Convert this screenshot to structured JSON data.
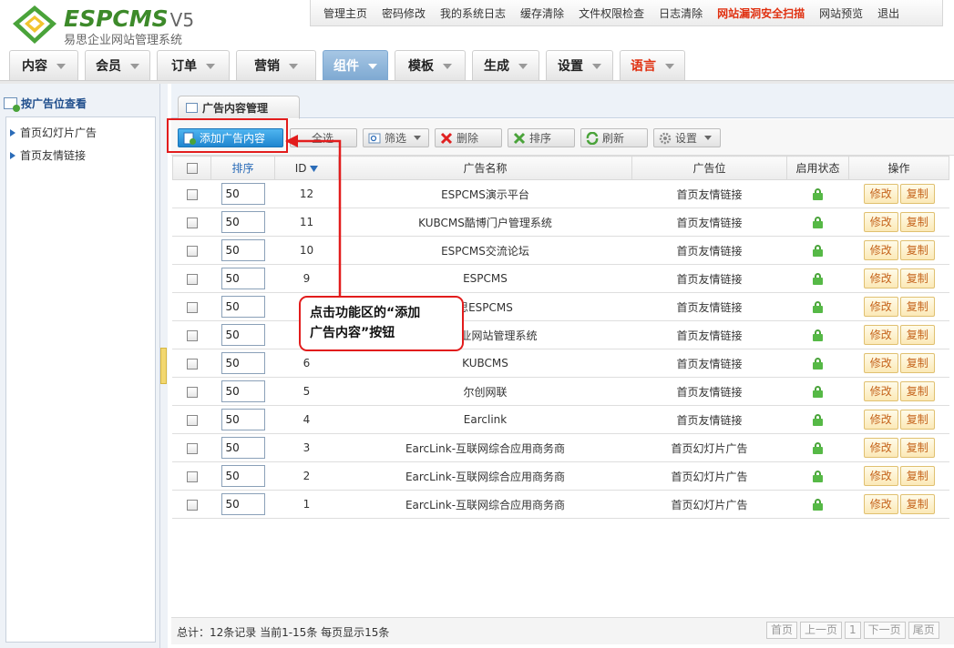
{
  "header": {
    "brand": "ESPCMS",
    "version": "V5",
    "subtitle": "易思企业网站管理系统"
  },
  "top_nav": [
    "管理主页",
    "密码修改",
    "我的系统日志",
    "缓存清除",
    "文件权限检查",
    "日志清除",
    "网站漏洞安全扫描",
    "网站预览",
    "退出"
  ],
  "main_nav": [
    "内容",
    "会员",
    "订单",
    "营销",
    "组件",
    "模板",
    "生成",
    "设置",
    "语言"
  ],
  "sidebar": {
    "title": "按广告位查看",
    "items": [
      "首页幻灯片广告",
      "首页友情链接"
    ]
  },
  "page_tab": "广告内容管理",
  "toolbar": {
    "add": "添加广告内容",
    "select_all": "全选",
    "filter": "筛选",
    "delete": "删除",
    "sort": "排序",
    "refresh": "刷新",
    "settings": "设置"
  },
  "table": {
    "headers": {
      "sort": "排序",
      "id": "ID",
      "name": "广告名称",
      "position": "广告位",
      "status": "启用状态",
      "ops": "操作"
    },
    "edit_label": "修改",
    "copy_label": "复制",
    "rows": [
      {
        "order": "50",
        "id": "12",
        "name": "ESPCMS演示平台",
        "position": "首页友情链接"
      },
      {
        "order": "50",
        "id": "11",
        "name": "KUBCMS酷博门户管理系统",
        "position": "首页友情链接"
      },
      {
        "order": "50",
        "id": "10",
        "name": "ESPCMS交流论坛",
        "position": "首页友情链接"
      },
      {
        "order": "50",
        "id": "9",
        "name": "ESPCMS",
        "position": "首页友情链接"
      },
      {
        "order": "50",
        "id": "",
        "name": "思ESPCMS",
        "position": "首页友情链接"
      },
      {
        "order": "50",
        "id": "",
        "name": "MS企业网站管理系统",
        "position": "首页友情链接"
      },
      {
        "order": "50",
        "id": "6",
        "name": "KUBCMS",
        "position": "首页友情链接"
      },
      {
        "order": "50",
        "id": "5",
        "name": "尔创网联",
        "position": "首页友情链接"
      },
      {
        "order": "50",
        "id": "4",
        "name": "Earclink",
        "position": "首页友情链接"
      },
      {
        "order": "50",
        "id": "3",
        "name": "EarcLink-互联网综合应用商务商",
        "position": "首页幻灯片广告"
      },
      {
        "order": "50",
        "id": "2",
        "name": "EarcLink-互联网综合应用商务商",
        "position": "首页幻灯片广告"
      },
      {
        "order": "50",
        "id": "1",
        "name": "EarcLink-互联网综合应用商务商",
        "position": "首页幻灯片广告"
      }
    ]
  },
  "callout": {
    "line1": "点击功能区的“添加",
    "line2": "广告内容”按钮"
  },
  "footer": {
    "summary": "总计：12条记录 当前1-15条 每页显示15条",
    "pager": [
      "首页",
      "上一页",
      "1",
      "下一页",
      "尾页"
    ]
  },
  "colors": {
    "accent_red": "#e21c1c",
    "brand_green": "#3d8a2a",
    "active_tab": "#7ea9d2",
    "primary_button": "#1f86d0"
  }
}
